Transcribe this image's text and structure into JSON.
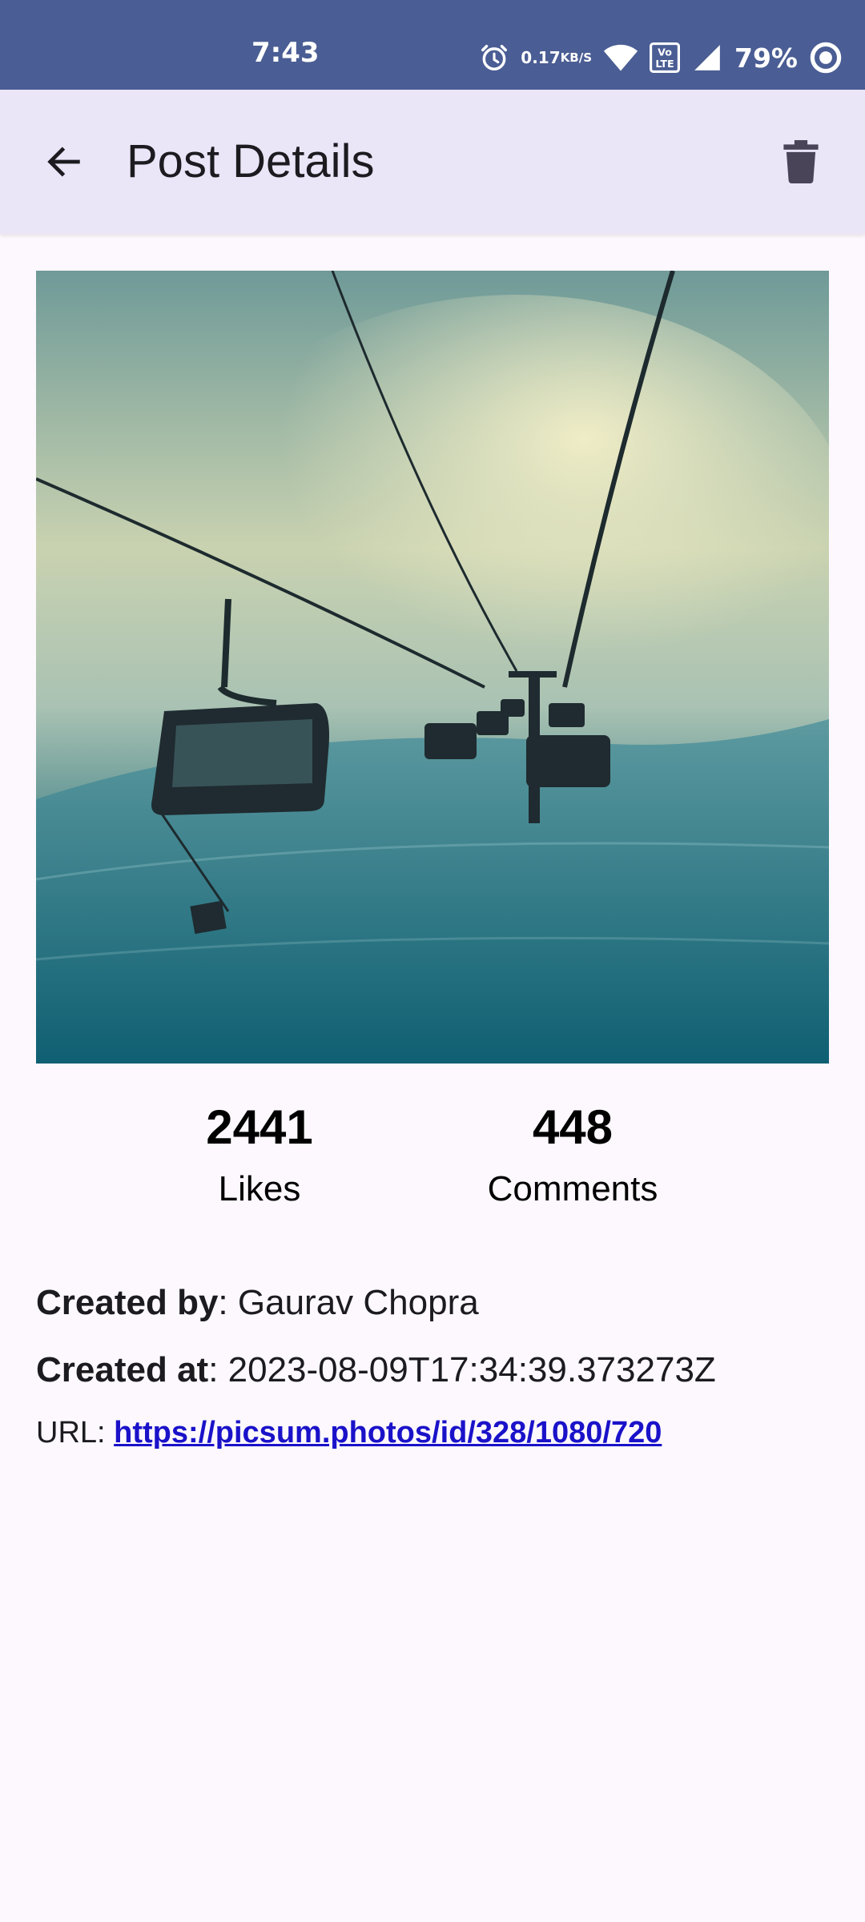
{
  "status_bar": {
    "time": "7:43",
    "net_speed_value": "0.17",
    "net_speed_unit": "KB/S",
    "battery": "79%",
    "icons": [
      "alarm-icon",
      "wifi-icon",
      "volte-icon",
      "signal-icon",
      "battery-ring-icon"
    ]
  },
  "app_bar": {
    "title": "Post Details",
    "back_icon": "arrow-left-icon",
    "delete_icon": "trash-icon"
  },
  "post": {
    "likes_count": "2441",
    "likes_label": "Likes",
    "comments_count": "448",
    "comments_label": "Comments",
    "created_by_label": "Created by",
    "created_by_value": "Gaurav Chopra",
    "created_at_label": "Created at",
    "created_at_value": "2023-08-09T17:34:39.373273Z",
    "url_label": "URL:",
    "url_value": "https://picsum.photos/id/328/1080/720"
  },
  "colors": {
    "status_bar": "#4a5d94",
    "app_bar": "#ebe5f8",
    "background": "#fcf8fd",
    "link": "#1a12c9"
  }
}
